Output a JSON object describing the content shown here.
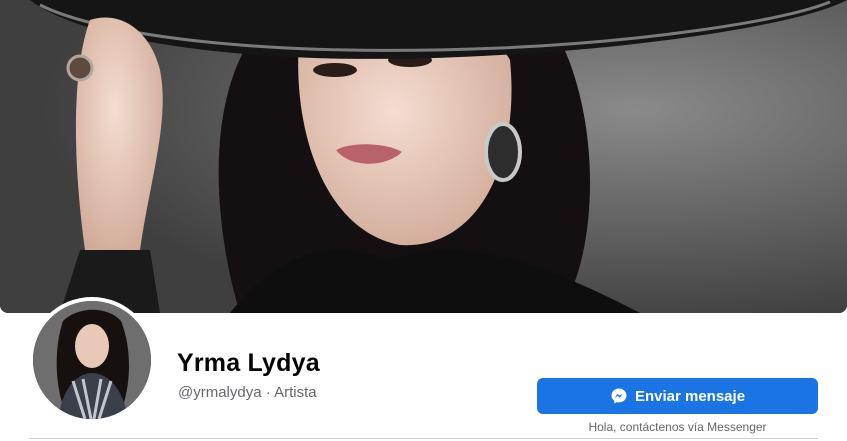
{
  "profile": {
    "name": "Yrma Lydya",
    "handle": "@yrmalydya",
    "separator": " · ",
    "category": "Artista"
  },
  "actions": {
    "message_button": "Enviar mensaje",
    "message_icon": "messenger-icon",
    "message_hint": "Hola, contáctenos vía Messenger"
  },
  "colors": {
    "primary_button": "#1b74e4",
    "name_text": "#050505",
    "secondary_text": "#65676b",
    "divider": "#ced0d4"
  }
}
